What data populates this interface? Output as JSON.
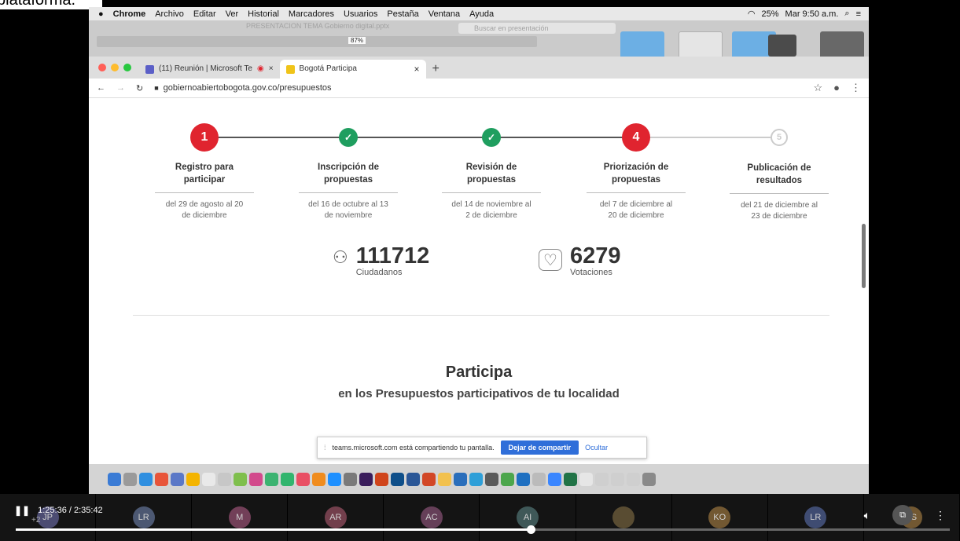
{
  "caption": "plataforma.",
  "menubar": {
    "app": "Chrome",
    "items": [
      "Archivo",
      "Editar",
      "Ver",
      "Historial",
      "Marcadores",
      "Usuarios",
      "Pestaña",
      "Ventana",
      "Ayuda"
    ],
    "battery": "25%",
    "clock": "Mar 9:50 a.m."
  },
  "ppt": {
    "zoom": "87%",
    "doc_title": "PRESENTACION TEMA Gobierno digital.pptx",
    "search_placeholder": "Buscar en presentación"
  },
  "tabs": [
    {
      "label": "(11) Reunión | Microsoft Te",
      "color": "#5b5fc7"
    },
    {
      "label": "Bogotá Participa",
      "color": "#f0c419"
    }
  ],
  "url": "gobiernoabiertobogota.gov.co/presupuestos",
  "steps": [
    {
      "marker": "1",
      "state": "red",
      "title1": "Registro para",
      "title2": "participar",
      "date1": "del 29 de agosto al 20",
      "date2": "de diciembre"
    },
    {
      "marker": "✓",
      "state": "green",
      "title1": "Inscripción de",
      "title2": "propuestas",
      "date1": "del 16 de octubre al 13",
      "date2": "de noviembre"
    },
    {
      "marker": "✓",
      "state": "green",
      "title1": "Revisión de",
      "title2": "propuestas",
      "date1": "del 14 de noviembre al",
      "date2": "2 de diciembre"
    },
    {
      "marker": "4",
      "state": "red",
      "title1": "Priorización de",
      "title2": "propuestas",
      "date1": "del 7 de diciembre al",
      "date2": "20 de diciembre"
    },
    {
      "marker": "5",
      "state": "gray",
      "title1": "Publicación de",
      "title2": "resultados",
      "date1": "del 21 de diciembre al",
      "date2": "23 de diciembre"
    }
  ],
  "stats": {
    "citizens_value": "111712",
    "citizens_label": "Ciudadanos",
    "votes_value": "6279",
    "votes_label": "Votaciones"
  },
  "participa": {
    "title": "Participa",
    "subtitle": "en los Presupuestos participativos de tu localidad"
  },
  "share_bar": {
    "message": "teams.microsoft.com está compartiendo tu pantalla.",
    "stop_label": "Dejar de compartir",
    "hide_label": "Ocultar"
  },
  "player": {
    "time": "1:25:36 / 2:35:42",
    "progress_fraction": 0.551,
    "extra_count": "+2",
    "participants": [
      "JP",
      "LR",
      "M",
      "AR",
      "AC",
      "AI",
      "",
      "KO",
      "LR",
      "LS"
    ]
  }
}
